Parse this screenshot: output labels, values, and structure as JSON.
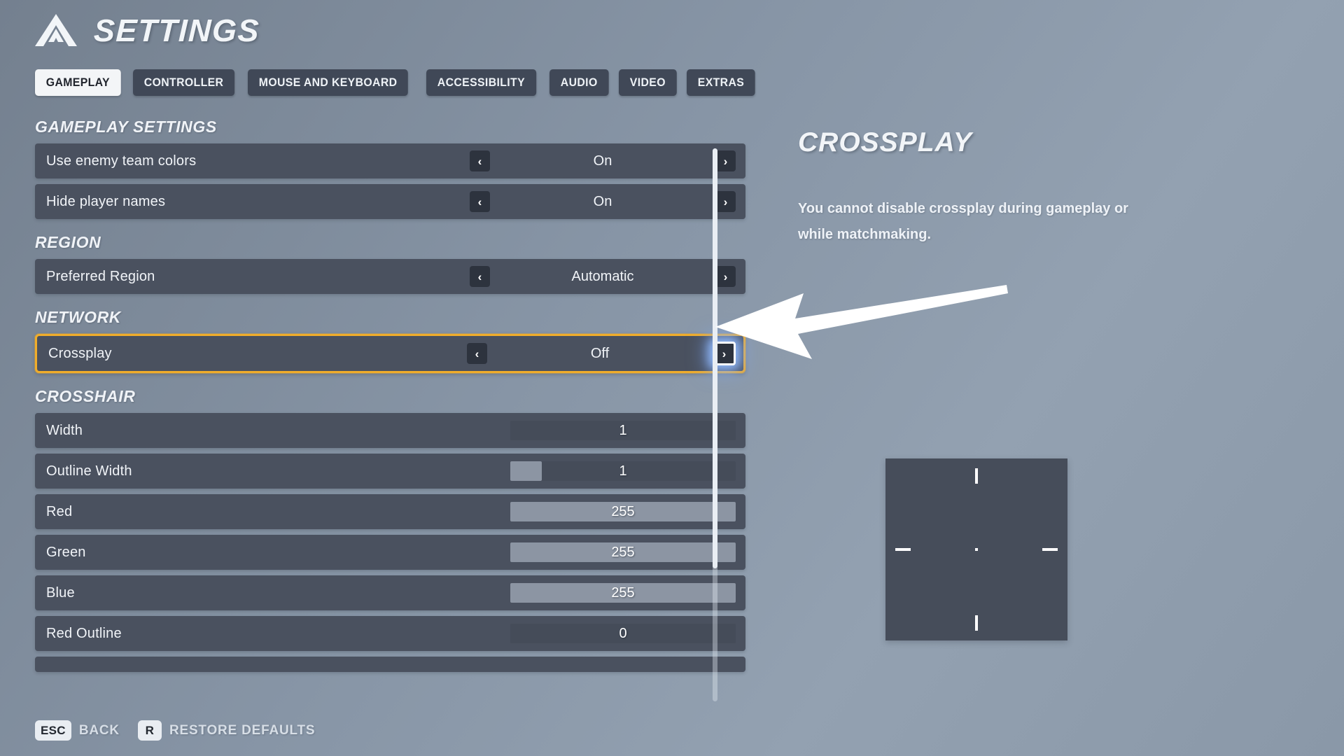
{
  "header": {
    "title": "SETTINGS",
    "logo_icon": "triangle-mountain-logo-icon"
  },
  "tabs": [
    {
      "label": "GAMEPLAY",
      "active": true
    },
    {
      "label": "CONTROLLER",
      "active": false
    },
    {
      "label": "MOUSE AND KEYBOARD",
      "active": false
    },
    {
      "label": "ACCESSIBILITY",
      "active": false
    },
    {
      "label": "AUDIO",
      "active": false
    },
    {
      "label": "VIDEO",
      "active": false
    },
    {
      "label": "EXTRAS",
      "active": false
    }
  ],
  "sections": [
    {
      "heading": "GAMEPLAY SETTINGS",
      "rows": [
        {
          "label": "Use enemy team colors",
          "type": "stepper",
          "value": "On",
          "focused": false
        },
        {
          "label": "Hide player names",
          "type": "stepper",
          "value": "On",
          "focused": false
        }
      ]
    },
    {
      "heading": "REGION",
      "rows": [
        {
          "label": "Preferred Region",
          "type": "stepper",
          "value": "Automatic",
          "focused": false
        }
      ]
    },
    {
      "heading": "NETWORK",
      "rows": [
        {
          "label": "Crossplay",
          "type": "stepper",
          "value": "Off",
          "focused": true,
          "right_arrow_selected": true
        }
      ]
    },
    {
      "heading": "CROSSHAIR",
      "rows": [
        {
          "label": "Width",
          "type": "slider",
          "value": "1",
          "fill_percent": 0
        },
        {
          "label": "Outline Width",
          "type": "slider",
          "value": "1",
          "fill_percent": 14
        },
        {
          "label": "Red",
          "type": "slider",
          "value": "255",
          "fill_percent": 100
        },
        {
          "label": "Green",
          "type": "slider",
          "value": "255",
          "fill_percent": 100
        },
        {
          "label": "Blue",
          "type": "slider",
          "value": "255",
          "fill_percent": 100
        },
        {
          "label": "Red Outline",
          "type": "slider",
          "value": "0",
          "fill_percent": 0
        }
      ]
    }
  ],
  "arrows": {
    "left_glyph": "‹",
    "right_glyph": "›",
    "left_icon": "chevron-left-icon",
    "right_icon": "chevron-right-icon"
  },
  "detail": {
    "title": "CROSSPLAY",
    "body": "You cannot disable crossplay during gameplay or while matchmaking."
  },
  "crosshair_preview": {
    "name": "crosshair-preview",
    "marks": [
      "top-tick",
      "bottom-tick",
      "left-tick",
      "right-tick",
      "center-dot"
    ]
  },
  "cursor": {
    "icon": "mouse-pointer-arrow"
  },
  "footer": {
    "hints": [
      {
        "key": "ESC",
        "label": "BACK"
      },
      {
        "key": "R",
        "label": "RESTORE DEFAULTS"
      }
    ]
  },
  "colors": {
    "background_top": "#74808f",
    "background_bottom": "#93a1b1",
    "row_bg": "#4a515f",
    "arrow_bg": "#2d333e",
    "focus_border": "#f0ad2b",
    "slider_fill": "#8c95a3",
    "tab_active_bg": "#f3f5f7",
    "tab_inactive_bg": "#404857",
    "preview_bg": "#464d5a",
    "text_primary": "#f1f4f8"
  }
}
